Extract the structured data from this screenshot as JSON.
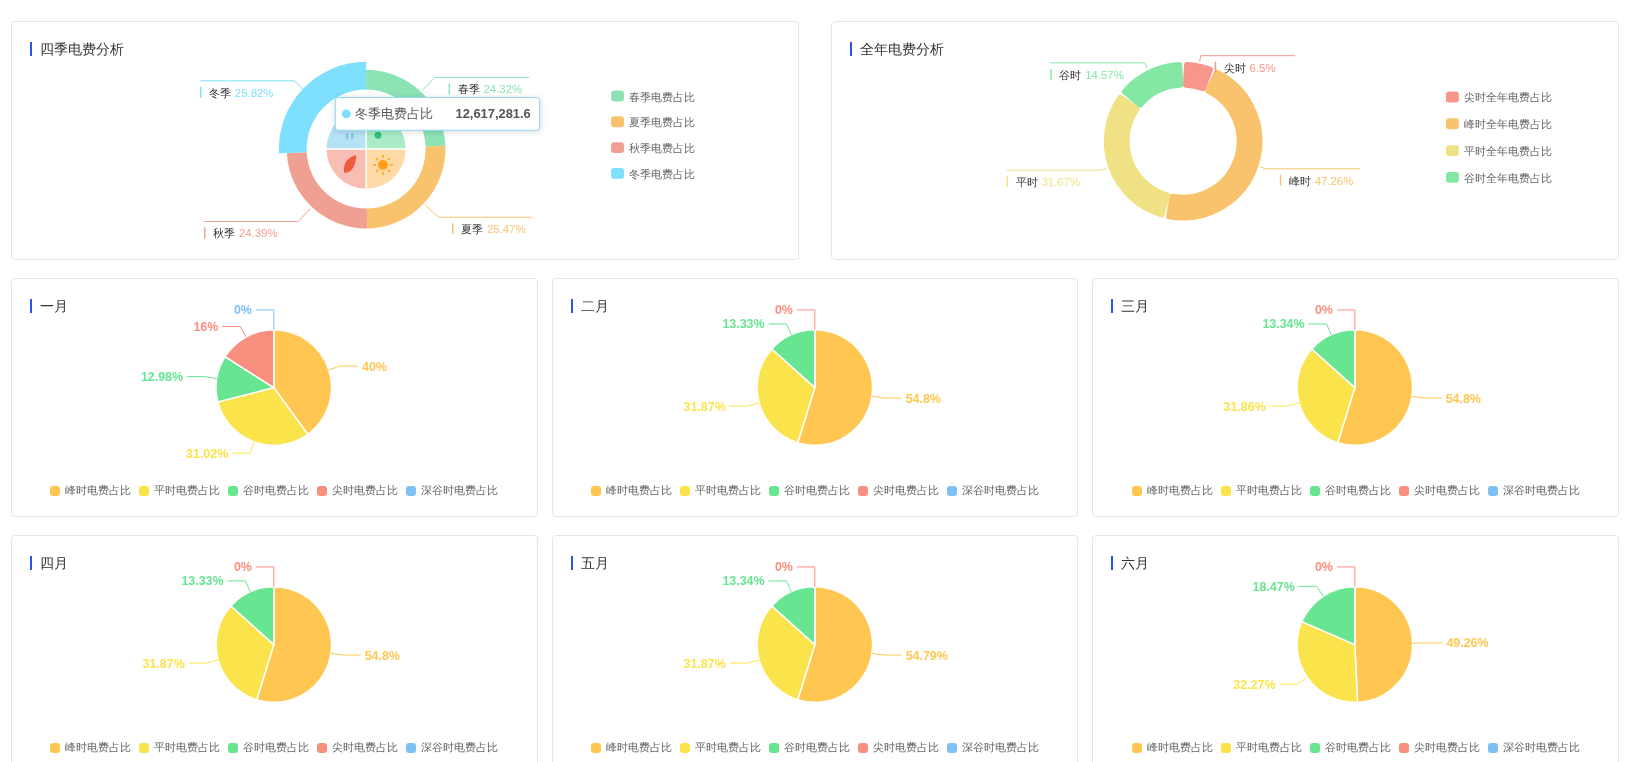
{
  "season_card": {
    "title": "四季电费分析",
    "chart_data": {
      "type": "donut",
      "categories": [
        "春季",
        "夏季",
        "秋季",
        "冬季"
      ],
      "values": [
        24.32,
        25.47,
        24.39,
        25.82
      ],
      "value_labels": [
        "24.32%",
        "25.47%",
        "24.39%",
        "25.82%"
      ],
      "legend": true
    },
    "slices": [
      {
        "color": "#8ce4b5",
        "hovered": false
      },
      {
        "color": "#f8c36c",
        "hovered": false
      },
      {
        "color": "#f0a093",
        "hovered": false
      },
      {
        "color": "#7ee0fc",
        "hovered": true
      }
    ],
    "legend": [
      "春季电费占比",
      "夏季电费占比",
      "秋季电费占比",
      "冬季电费占比"
    ],
    "tooltip": {
      "label": "冬季电费占比",
      "value": "12,617,281.6"
    }
  },
  "year_card": {
    "title": "全年电费分析",
    "chart_data": {
      "type": "donut",
      "categories": [
        "尖时",
        "峰时",
        "平时",
        "谷时"
      ],
      "values": [
        6.5,
        47.26,
        31.67,
        14.57
      ],
      "value_labels": [
        "6.5%",
        "47.26%",
        "31.67%",
        "14.57%"
      ],
      "legend": true
    },
    "slices": [
      {
        "color": "#f7968a"
      },
      {
        "color": "#f8c36c"
      },
      {
        "color": "#f0e284"
      },
      {
        "color": "#84e8a4"
      }
    ],
    "legend": [
      "尖时全年电费占比",
      "峰时全年电费占比",
      "平时全年电费占比",
      "谷时全年电费占比"
    ]
  },
  "month_cards": [
    {
      "title": "一月",
      "chart_data": {
        "type": "pie",
        "categories": [
          "峰时电费占比",
          "平时电费占比",
          "谷时电费占比",
          "尖时电费占比",
          "深谷时电费占比"
        ],
        "values": [
          40,
          31.02,
          12.98,
          16,
          0
        ],
        "value_labels": [
          "40%",
          "31.02%",
          "12.98%",
          "16%",
          "0%"
        ],
        "legend": true
      },
      "slices": [
        {
          "color": "#ffc751"
        },
        {
          "color": "#fbe44b"
        },
        {
          "color": "#68e591"
        },
        {
          "color": "#f98f7f"
        },
        {
          "color": "#7ec1f5"
        }
      ]
    },
    {
      "title": "二月",
      "chart_data": {
        "type": "pie",
        "categories": [
          "峰时电费占比",
          "平时电费占比",
          "谷时电费占比",
          "尖时电费占比",
          "深谷时电费占比"
        ],
        "values": [
          54.8,
          31.87,
          13.33,
          0,
          null
        ],
        "value_labels": [
          "54.8%",
          "31.87%",
          "13.33%",
          "0%",
          null
        ],
        "legend": true
      },
      "slices": [
        {
          "color": "#ffc751"
        },
        {
          "color": "#fbe44b"
        },
        {
          "color": "#68e591"
        },
        {
          "color": "#f98f7f"
        },
        {
          "color": "#7ec1f5"
        }
      ]
    },
    {
      "title": "三月",
      "chart_data": {
        "type": "pie",
        "categories": [
          "峰时电费占比",
          "平时电费占比",
          "谷时电费占比",
          "尖时电费占比",
          "深谷时电费占比"
        ],
        "values": [
          54.8,
          31.86,
          13.34,
          0,
          null
        ],
        "value_labels": [
          "54.8%",
          "31.86%",
          "13.34%",
          "0%",
          null
        ],
        "legend": true
      },
      "slices": [
        {
          "color": "#ffc751"
        },
        {
          "color": "#fbe44b"
        },
        {
          "color": "#68e591"
        },
        {
          "color": "#f98f7f"
        },
        {
          "color": "#7ec1f5"
        }
      ]
    },
    {
      "title": "四月",
      "chart_data": {
        "type": "pie",
        "categories": [
          "峰时电费占比",
          "平时电费占比",
          "谷时电费占比",
          "尖时电费占比",
          "深谷时电费占比"
        ],
        "values": [
          54.8,
          31.87,
          13.33,
          0,
          null
        ],
        "value_labels": [
          "54.8%",
          "31.87%",
          "13.33%",
          "0%",
          null
        ],
        "legend": true
      },
      "slices": [
        {
          "color": "#ffc751"
        },
        {
          "color": "#fbe44b"
        },
        {
          "color": "#68e591"
        },
        {
          "color": "#f98f7f"
        },
        {
          "color": "#7ec1f5"
        }
      ]
    },
    {
      "title": "五月",
      "chart_data": {
        "type": "pie",
        "categories": [
          "峰时电费占比",
          "平时电费占比",
          "谷时电费占比",
          "尖时电费占比",
          "深谷时电费占比"
        ],
        "values": [
          54.79,
          31.87,
          13.34,
          0,
          null
        ],
        "value_labels": [
          "54.79%",
          "31.87%",
          "13.34%",
          "0%",
          null
        ],
        "legend": true
      },
      "slices": [
        {
          "color": "#ffc751"
        },
        {
          "color": "#fbe44b"
        },
        {
          "color": "#68e591"
        },
        {
          "color": "#f98f7f"
        },
        {
          "color": "#7ec1f5"
        }
      ]
    },
    {
      "title": "六月",
      "chart_data": {
        "type": "pie",
        "categories": [
          "峰时电费占比",
          "平时电费占比",
          "谷时电费占比",
          "尖时电费占比",
          "深谷时电费占比"
        ],
        "values": [
          49.26,
          32.27,
          18.47,
          0,
          null
        ],
        "value_labels": [
          "49.26%",
          "32.27%",
          "18.47%",
          "0%",
          null
        ],
        "legend": true
      },
      "slices": [
        {
          "color": "#ffc751"
        },
        {
          "color": "#fbe44b"
        },
        {
          "color": "#68e591"
        },
        {
          "color": "#f98f7f"
        },
        {
          "color": "#7ec1f5"
        }
      ]
    }
  ]
}
